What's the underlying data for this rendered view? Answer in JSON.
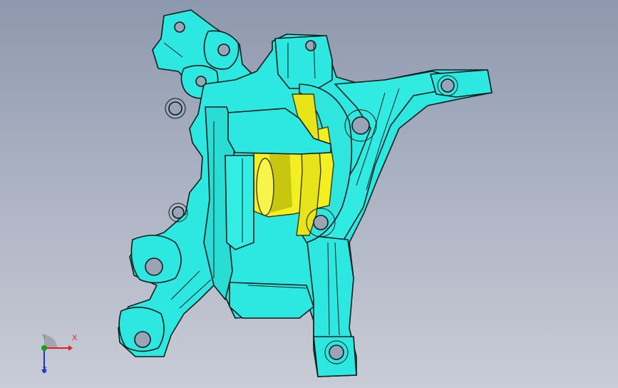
{
  "viewport": {
    "background_top": "#8e98ae",
    "background_bottom": "#c9ccd6"
  },
  "model": {
    "description_icon": "steering-knuckle-cad-model",
    "body_color": "#2de8e0",
    "hub_color": "#f2ef22",
    "edge_color": "#0b1c1c"
  },
  "triad": {
    "x_label": "X",
    "y_label": "Y",
    "z_label": "Z",
    "x_color": "#dd2222",
    "y_color": "#1e9a1e",
    "z_color": "#2233cc"
  }
}
